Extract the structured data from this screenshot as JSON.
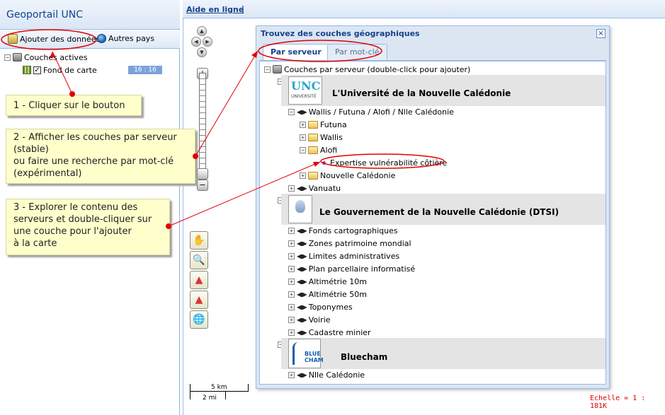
{
  "left_panel": {
    "title": "Geoportail UNC",
    "toolbar": {
      "add_data_label": "Ajouter des données",
      "other_countries_label": "Autres pays"
    },
    "tree": {
      "root_label": "Couches actives",
      "layer_label": "Fond de carte",
      "layer_scale": "16 : 16"
    }
  },
  "map": {
    "help_link": "Aide en ligne",
    "help_sep": "|",
    "scale_km": "5 km",
    "scale_mi": "2 mi",
    "scale_ratio": "Echelle = 1 : 181K"
  },
  "callouts": {
    "step1": "1 - Cliquer sur le bouton",
    "step2": "2 - Afficher les couches par serveur (stable)\nou faire une recherche par mot-clé (expérimental)",
    "step3": "3 - Explorer le contenu des serveurs et double-cliquer sur une couche pour l'ajouter\nà la carte"
  },
  "dialog": {
    "title": "Trouvez des couches géographiques",
    "close": "×",
    "tabs": {
      "server": "Par serveur",
      "keyword": "Par mot-clé"
    },
    "root_label": "Couches par serveur (double-click pour ajouter)",
    "servers": [
      {
        "name": "L'Université de la Nouvelle Calédonie",
        "logo_text": "UNC",
        "logo_sub": "UNIVERSITÉ",
        "nodes": {
          "wallis": "Wallis / Futuna / Alofi / Nlle Calédonie",
          "futuna": "Futuna",
          "wallis_sub": "Wallis",
          "alofi": "Alofi",
          "expertise": "Expertise vulnérabilité côtière",
          "nouvelle_caledonie": "Nouvelle Calédonie",
          "vanuatu": "Vanuatu"
        }
      },
      {
        "name": "Le Gouvernement de la Nouvelle Calédonie (DTSI)",
        "layers": [
          "Fonds cartographiques",
          "Zones patrimoine mondial",
          "Limites administratives",
          "Plan parcellaire informatisé",
          "Altimétrie 10m",
          "Altimétrie 50m",
          "Toponymes",
          "Voirie",
          "Cadastre minier"
        ]
      },
      {
        "name": "Bluecham",
        "logo_text": "BLUE CHAM",
        "layers": [
          "Nlle Calédonie"
        ]
      }
    ]
  },
  "colors": {
    "accent": "#15428b",
    "callout_bg": "#ffffcc",
    "annotation_red": "#e30000",
    "server_header_bg": "#e4e4e4"
  }
}
